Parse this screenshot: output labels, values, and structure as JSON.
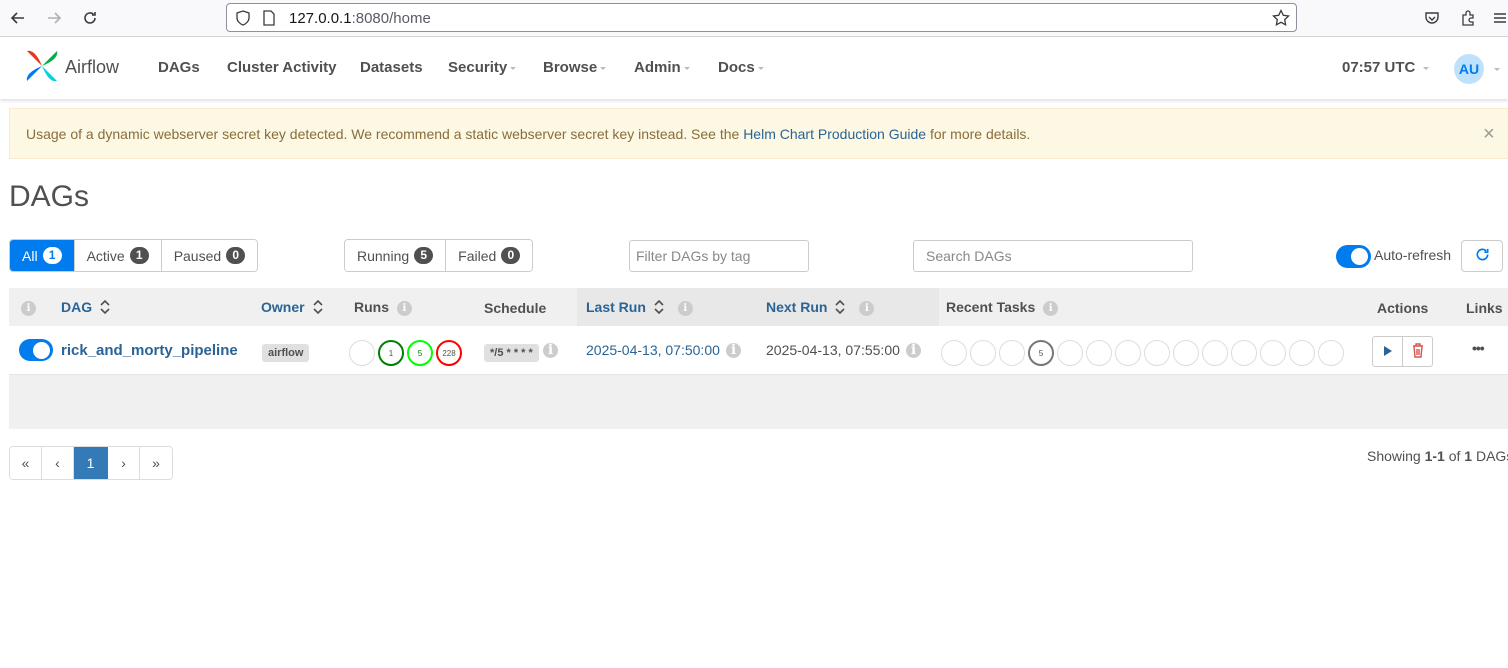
{
  "browser": {
    "url_host": "127.0.0.1",
    "url_rest": ":8080/home"
  },
  "nav": {
    "brand": "Airflow",
    "items": [
      "DAGs",
      "Cluster Activity",
      "Datasets",
      "Security",
      "Browse",
      "Admin",
      "Docs"
    ],
    "time": "07:57 UTC",
    "user_initials": "AU"
  },
  "alert": {
    "text_before": "Usage of a dynamic webserver secret key detected. We recommend a static webserver secret key instead. See the ",
    "link_text": "Helm Chart Production Guide",
    "text_after": " for more details.",
    "close": "×"
  },
  "page_title": "DAGs",
  "filters": {
    "status": [
      {
        "label": "All",
        "count": "1",
        "active": true
      },
      {
        "label": "Active",
        "count": "1"
      },
      {
        "label": "Paused",
        "count": "0"
      }
    ],
    "run_state": [
      {
        "label": "Running",
        "count": "5"
      },
      {
        "label": "Failed",
        "count": "0"
      }
    ],
    "tag_placeholder": "Filter DAGs by tag",
    "search_placeholder": "Search DAGs",
    "auto_refresh_label": "Auto-refresh"
  },
  "table": {
    "headers": {
      "info": "i",
      "dag": "DAG",
      "owner": "Owner",
      "runs": "Runs",
      "schedule": "Schedule",
      "last_run": "Last Run",
      "next_run": "Next Run",
      "recent_tasks": "Recent Tasks",
      "actions": "Actions",
      "links": "Links"
    },
    "rows": [
      {
        "dag_id": "rick_and_morty_pipeline",
        "owner": "airflow",
        "runs": [
          "",
          "1",
          "5",
          "228"
        ],
        "schedule": "*/5 * * * *",
        "last_run": "2025-04-13, 07:50:00",
        "next_run": "2025-04-13, 07:55:00",
        "recent_tasks": [
          "",
          "",
          "",
          "5",
          "",
          "",
          "",
          "",
          "",
          "",
          "",
          "",
          "",
          ""
        ],
        "links": "•••"
      }
    ]
  },
  "pagination": {
    "first": "«",
    "prev": "‹",
    "current": "1",
    "next": "›",
    "last": "»",
    "showing_prefix": "Showing ",
    "showing_range": "1-1",
    "showing_of": " of ",
    "showing_total": "1",
    "showing_suffix": " DAGs"
  },
  "colors": {
    "primary": "#017cee",
    "run_success": "#008000",
    "run_running": "#00ff00",
    "run_failed": "#ff0000",
    "task_scheduled": "#51504f"
  }
}
